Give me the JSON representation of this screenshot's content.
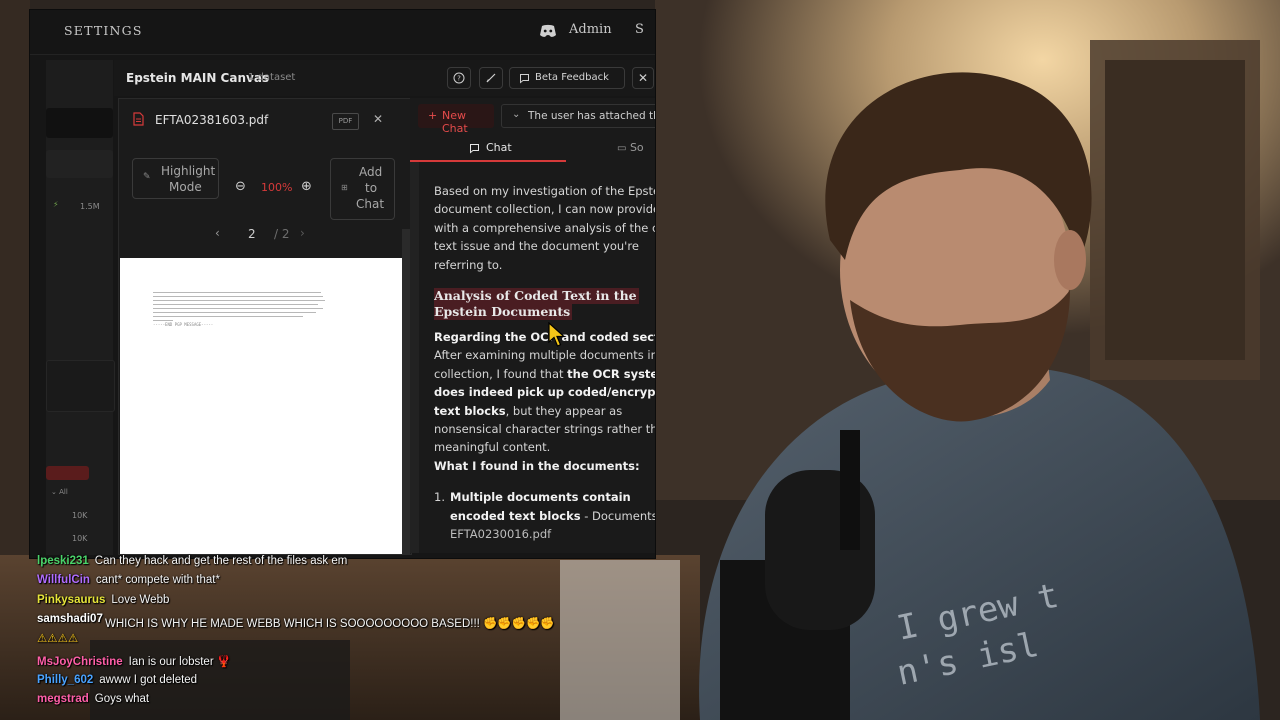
{
  "app": {
    "title": "SETTINGS",
    "admin_label": "Admin",
    "top_right_fragment": "S",
    "left_nav": {
      "stat_label": "1.5M",
      "filter_label": "All",
      "counts": [
        "10K",
        "10K"
      ]
    }
  },
  "canvas": {
    "title": "Epstein MAIN Canvas",
    "dataset_count": "1 dataset",
    "beta_label": "Beta Feedback"
  },
  "pdf_viewer": {
    "file_name": "EFTA02381603.pdf",
    "badge": "PDF",
    "highlight_label_1": "Highlight",
    "highlight_label_2": "Mode",
    "zoom": "100%",
    "add_label_1": "Add",
    "add_label_2": "to",
    "add_label_3": "Chat",
    "page_current": "2",
    "page_total": "/ 2",
    "end_text": "-----END PGP MESSAGE-----"
  },
  "chat_panel": {
    "new_chat": "New Chat",
    "user_select": "The user has attached the",
    "tab_chat": "Chat",
    "tab_sources": "So",
    "message": {
      "intro_lines": [
        "Based on my investigation of the Epstein",
        "document collection, I can now provide",
        "with a comprehensive analysis of the co",
        "text issue and the document you're",
        "referring to."
      ],
      "heading_line1": "Analysis of Coded Text in the",
      "heading_line2": "Epstein Documents",
      "reg_bold": "Regarding the OCR and coded sectio",
      "body_l1": "After examining multiple documents in t",
      "body_l2_pre": "collection, I found that ",
      "body_l2_bold": "the OCR system",
      "body_l3_bold": "does indeed pick up coded/encrypt",
      "body_l4_bold": "text blocks",
      "body_l4_post": ", but they appear as",
      "body_l5": "nonsensical character strings rather tha",
      "body_l6": "meaningful content.",
      "found_heading": "What I found in the documents:",
      "item1_num": "1.",
      "item1_bold_l1": "Multiple documents contain",
      "item1_bold_l2": "encoded text blocks",
      "item1_post": " - Documents",
      "item1_trail": "EFTA0230016.pdf"
    }
  },
  "twitch_chat": [
    {
      "user": "lpeski231",
      "color": "#4ad36a",
      "text": "Can they hack and get the rest of the files ask em"
    },
    {
      "user": "WillfulCin",
      "color": "#b06cff",
      "text": "cant* compete with that*"
    },
    {
      "user": "Pinkysaurus",
      "color": "#e6e43a",
      "text": "Love Webb"
    },
    {
      "user": "",
      "color": "#ffffff",
      "text": "WHICH IS WHY HE MADE WEBB WHICH IS SOOOOOOOOO BASED!!! ✊✊✊✊✊"
    },
    {
      "user": "samshadi07",
      "color": "#ffffff",
      "text": ""
    },
    {
      "user": "",
      "color": "#ffffff",
      "text": "⚠⚠⚠⚠"
    },
    {
      "user": "MsJoyChristine",
      "color": "#ff5fa8",
      "text": "Ian is our lobster 🦞"
    },
    {
      "user": "Philly_602",
      "color": "#4aa3ff",
      "text": "awww I got deleted"
    },
    {
      "user": "megstrad",
      "color": "#ff5fa8",
      "text": "Goys what"
    }
  ],
  "colors": {
    "accent_red": "#d63a3a",
    "app_bg": "#161616"
  }
}
